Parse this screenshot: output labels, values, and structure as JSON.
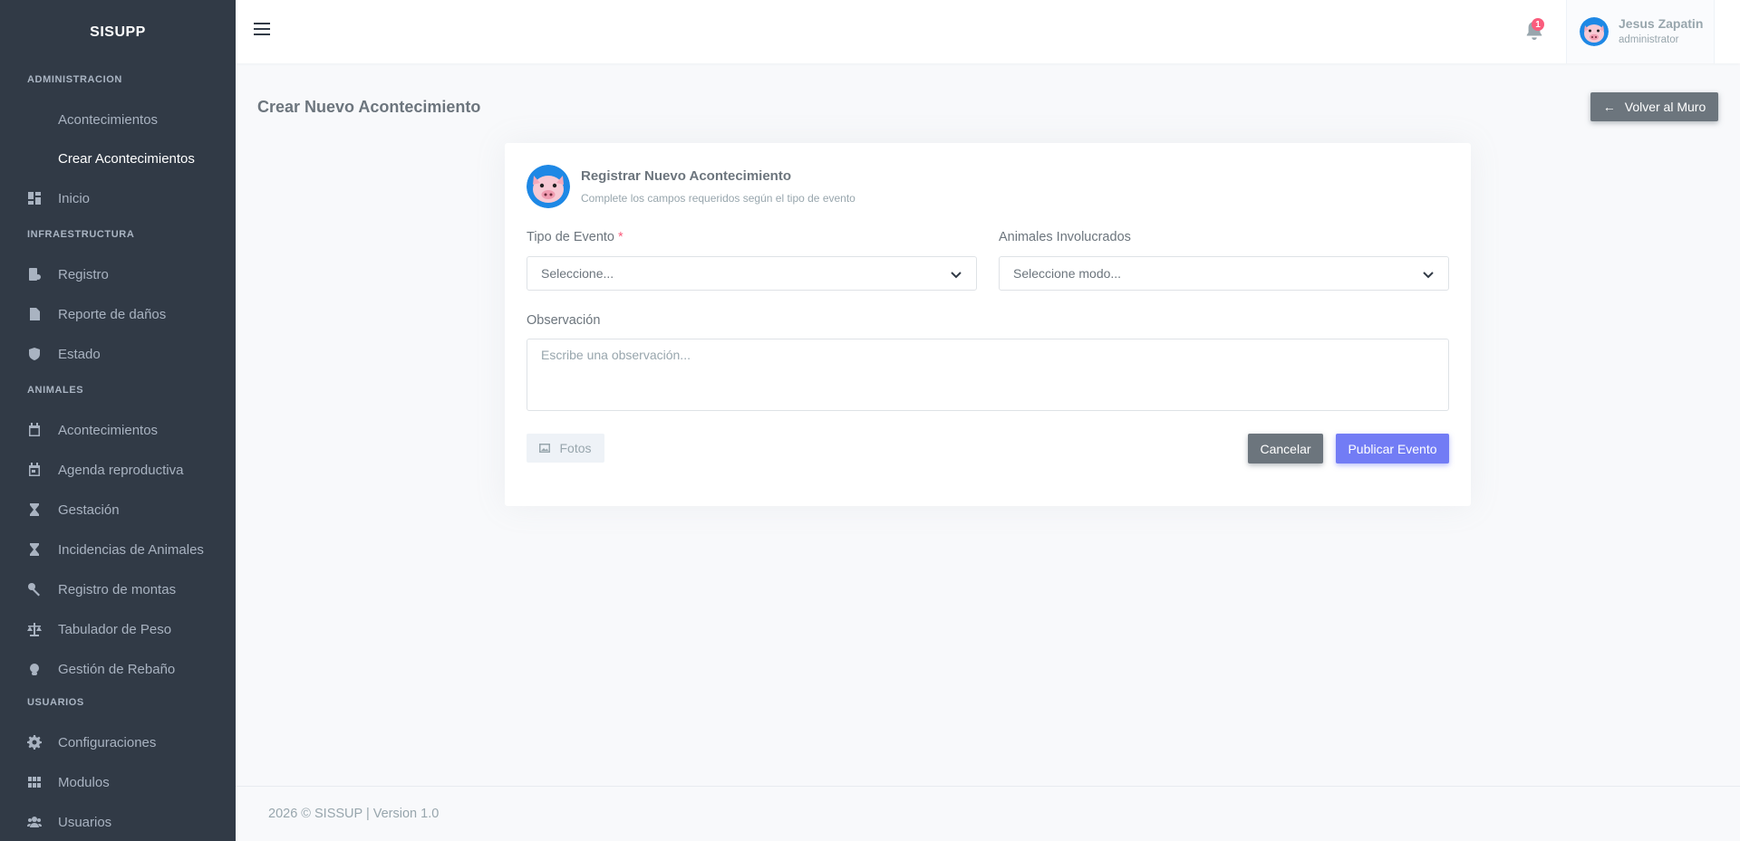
{
  "brand": "SISUPP",
  "sidebar": {
    "sections": [
      {
        "title": "ADMINISTRACION",
        "items": [
          {
            "label": "Acontecimientos",
            "type": "sub"
          },
          {
            "label": "Crear Acontecimientos",
            "type": "sub",
            "active": true
          },
          {
            "label": "Inicio",
            "icon": "dashboard-icon"
          }
        ]
      },
      {
        "title": "INFRAESTRUCTURA",
        "items": [
          {
            "label": "Registro",
            "icon": "register-icon"
          },
          {
            "label": "Reporte de daños",
            "icon": "file-icon"
          },
          {
            "label": "Estado",
            "icon": "shield-check-icon"
          }
        ]
      },
      {
        "title": "ANIMALES",
        "items": [
          {
            "label": "Acontecimientos",
            "icon": "calendar-icon"
          },
          {
            "label": "Agenda reproductiva",
            "icon": "calendar-check-icon"
          },
          {
            "label": "Gestación",
            "icon": "hourglass-icon"
          },
          {
            "label": "Incidencias de Animales",
            "icon": "hourglass-icon"
          },
          {
            "label": "Registro de montas",
            "icon": "gender-icon"
          },
          {
            "label": "Tabulador de Peso",
            "icon": "scale-icon"
          },
          {
            "label": "Gestión de Rebaño",
            "icon": "herd-icon"
          }
        ]
      },
      {
        "title": "USUARIOS",
        "items": [
          {
            "label": "Configuraciones",
            "icon": "gear-icon"
          },
          {
            "label": "Modulos",
            "icon": "grid-icon"
          },
          {
            "label": "Usuarios",
            "icon": "users-icon"
          }
        ]
      }
    ]
  },
  "topbar": {
    "notification_count": "1",
    "user_name": "Jesus Zapatin",
    "user_role": "administrator"
  },
  "page": {
    "title": "Crear Nuevo Acontecimiento",
    "back_label": "Volver al Muro"
  },
  "form": {
    "header_title": "Registrar Nuevo Acontecimiento",
    "header_subtitle": "Complete los campos requeridos según el tipo de evento",
    "event_type_label": "Tipo de Evento",
    "event_type_required": "*",
    "event_type_value": "Seleccione...",
    "animals_label": "Animales Involucrados",
    "animals_value": "Seleccione modo...",
    "observation_label": "Observación",
    "observation_placeholder": "Escribe una observación...",
    "photos_label": "Fotos",
    "cancel_label": "Cancelar",
    "publish_label": "Publicar Evento"
  },
  "footer": {
    "text": "2026 © SISSUP | Version 1.0"
  },
  "colors": {
    "sidebar_bg": "#313a46",
    "primary": "#727cf5",
    "secondary": "#6c757d",
    "danger": "#fa5c7c"
  }
}
